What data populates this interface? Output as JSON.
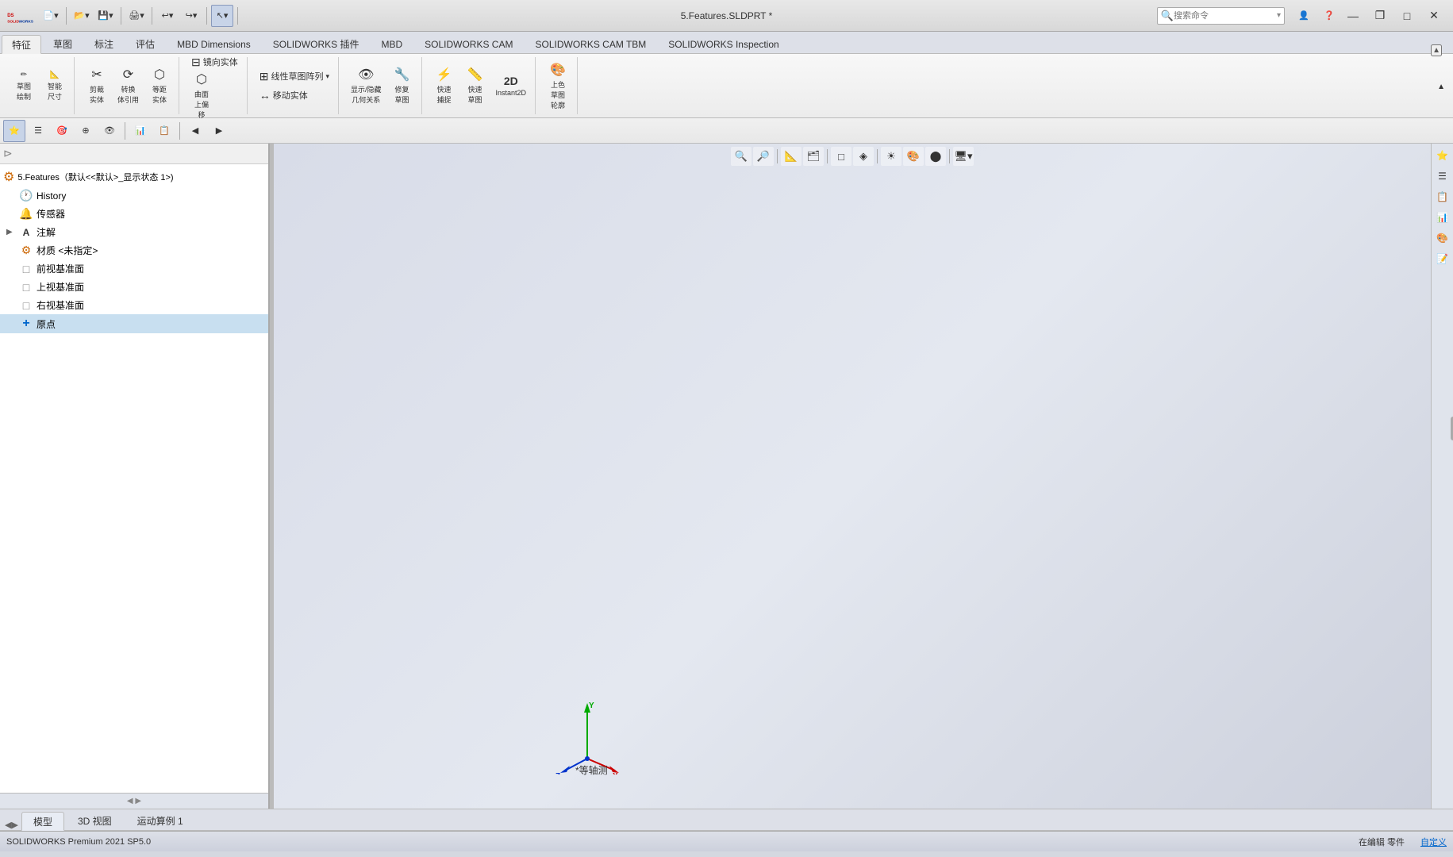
{
  "titlebar": {
    "logo_alt": "SOLIDWORKS",
    "title": "5.Features.SLDPRT *",
    "search_placeholder": "搜索命令",
    "window_controls": {
      "minimize": "—",
      "restore": "❐",
      "maximize": "□",
      "close": "✕"
    }
  },
  "toolbar_buttons": [
    {
      "name": "new",
      "icon": "📄",
      "label": ""
    },
    {
      "name": "open",
      "icon": "📂",
      "label": ""
    },
    {
      "name": "save",
      "icon": "💾",
      "label": ""
    },
    {
      "name": "print",
      "icon": "🖨",
      "label": ""
    },
    {
      "name": "undo",
      "icon": "↩",
      "label": ""
    },
    {
      "name": "redo",
      "icon": "↪",
      "label": ""
    },
    {
      "name": "select",
      "icon": "↖",
      "label": ""
    }
  ],
  "ribbon_tabs": [
    {
      "label": "特征",
      "active": true
    },
    {
      "label": "草图",
      "active": false
    },
    {
      "label": "标注",
      "active": false
    },
    {
      "label": "评估",
      "active": false
    },
    {
      "label": "MBD Dimensions",
      "active": false
    },
    {
      "label": "SOLIDWORKS 插件",
      "active": false
    },
    {
      "label": "MBD",
      "active": false
    },
    {
      "label": "SOLIDWORKS CAM",
      "active": false
    },
    {
      "label": "SOLIDWORKS CAM TBM",
      "active": false
    },
    {
      "label": "SOLIDWORKS Inspection",
      "active": false
    }
  ],
  "ribbon_groups": [
    {
      "name": "sketch-tools",
      "buttons": [
        {
          "label": "草图\n绘制",
          "icon": "✏"
        },
        {
          "label": "智能\n尺寸",
          "icon": "📐"
        }
      ]
    },
    {
      "name": "cut-convert",
      "buttons": [
        {
          "label": "剪裁\n实体",
          "icon": "✂"
        },
        {
          "label": "转换\n体引用",
          "icon": "🔄"
        },
        {
          "label": "等距\n实体",
          "icon": "⬡"
        }
      ]
    }
  ],
  "ribbon_items": [
    {
      "label": "镜向实体",
      "icon": "⊟"
    },
    {
      "label": "曲面\n上偏\n移",
      "icon": "⬡"
    },
    {
      "label": "线性草图阵列",
      "icon": "⊞"
    },
    {
      "label": "移动实体",
      "icon": "↔"
    },
    {
      "label": "显示/隐藏\n几何关系",
      "icon": "👁"
    },
    {
      "label": "修复\n草图",
      "icon": "🔧"
    },
    {
      "label": "快速\n捕捉",
      "icon": "🎯"
    },
    {
      "label": "快速\n草图",
      "icon": "📏"
    },
    {
      "label": "Instant2D",
      "icon": "2D"
    },
    {
      "label": "上色\n草图\n轮廓",
      "icon": "🎨"
    }
  ],
  "panel_toolbar": [
    {
      "icon": "⭐",
      "name": "feature-manager",
      "active": true
    },
    {
      "icon": "☰",
      "name": "property-manager",
      "active": false
    },
    {
      "icon": "🎯",
      "name": "config-manager",
      "active": false
    },
    {
      "icon": "⊕",
      "name": "dim-xpert",
      "active": false
    },
    {
      "icon": "👁",
      "name": "display-manager",
      "active": false
    },
    {
      "icon": "📊",
      "name": "cam-manager",
      "active": false
    },
    {
      "icon": "🔬",
      "name": "inspection-manager",
      "active": false
    },
    {
      "icon": "◀",
      "name": "collapse",
      "active": false
    },
    {
      "icon": "▶",
      "name": "expand",
      "active": false
    }
  ],
  "feature_tree": {
    "root": "5.Features（默认<<默认>_显示状态 1>)",
    "items": [
      {
        "label": "History",
        "icon": "🕐",
        "type": "history",
        "indent": 0
      },
      {
        "label": "传感器",
        "icon": "🔔",
        "type": "sensor",
        "indent": 0
      },
      {
        "label": "注解",
        "icon": "A",
        "type": "annotation",
        "indent": 0,
        "expandable": true
      },
      {
        "label": "材质 <未指定>",
        "icon": "⚙",
        "type": "material",
        "indent": 0
      },
      {
        "label": "前视基准面",
        "icon": "□",
        "type": "plane",
        "indent": 0
      },
      {
        "label": "上视基准面",
        "icon": "□",
        "type": "plane",
        "indent": 0
      },
      {
        "label": "右视基准面",
        "icon": "□",
        "type": "plane",
        "indent": 0
      },
      {
        "label": "原点",
        "icon": "+",
        "type": "origin",
        "indent": 0,
        "selected": true
      }
    ]
  },
  "view_toolbar_buttons": [
    {
      "icon": "🔍",
      "name": "zoom-to-fit"
    },
    {
      "icon": "🔎",
      "name": "zoom-in"
    },
    {
      "icon": "📐",
      "name": "standard-views"
    },
    {
      "icon": "🗂",
      "name": "view-orient"
    },
    {
      "icon": "□",
      "name": "section-view"
    },
    {
      "icon": "◈",
      "name": "display-style"
    },
    {
      "icon": "☀",
      "name": "lighting"
    },
    {
      "icon": "🎨",
      "name": "appearance"
    },
    {
      "icon": "🖥",
      "name": "scenes"
    },
    {
      "icon": "⊞",
      "name": "view-settings"
    }
  ],
  "view_label": "*等轴测",
  "bottom_tabs": [
    {
      "label": "模型",
      "active": true
    },
    {
      "label": "3D 视图",
      "active": false
    },
    {
      "label": "运动算例 1",
      "active": false
    }
  ],
  "status_bar": {
    "left": "SOLIDWORKS Premium 2021 SP5.0",
    "middle": "在编辑 零件",
    "right": "自定义"
  },
  "right_panel_buttons": [
    {
      "icon": "⭐",
      "name": "rp-feature"
    },
    {
      "icon": "☰",
      "name": "rp-property"
    },
    {
      "icon": "📋",
      "name": "rp-config"
    },
    {
      "icon": "📊",
      "name": "rp-display"
    },
    {
      "icon": "🎨",
      "name": "rp-appearance"
    },
    {
      "icon": "📝",
      "name": "rp-notes"
    }
  ]
}
